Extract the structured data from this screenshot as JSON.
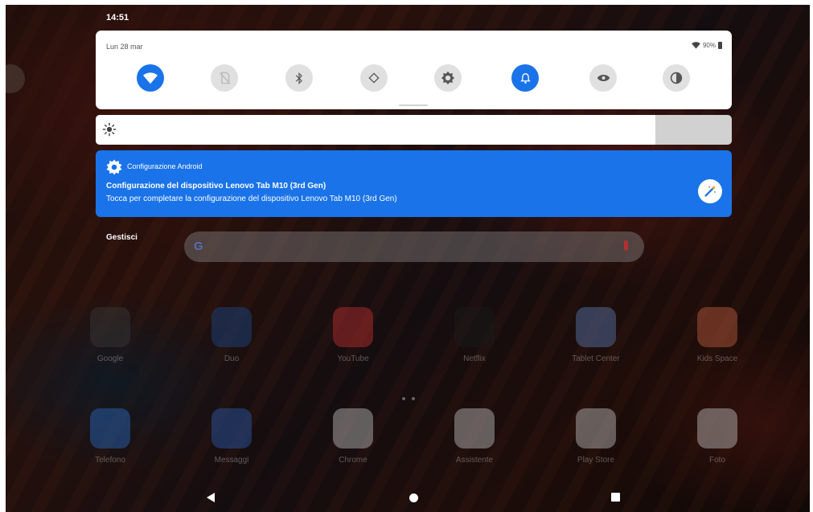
{
  "status_bar": {
    "time": "14:51"
  },
  "quick_settings": {
    "date": "Lun 28 mar",
    "battery": "90%",
    "tiles": [
      {
        "icon": "wifi-icon",
        "active": true
      },
      {
        "icon": "no-sim-icon",
        "active": false
      },
      {
        "icon": "bluetooth-icon",
        "active": false
      },
      {
        "icon": "auto-rotate-icon",
        "active": false
      },
      {
        "icon": "brightness-auto-icon",
        "active": false
      },
      {
        "icon": "bell-icon",
        "active": true
      },
      {
        "icon": "eye-icon",
        "active": false
      },
      {
        "icon": "contrast-icon",
        "active": false
      }
    ]
  },
  "brightness": {
    "level_percent": 88
  },
  "notification": {
    "app_name": "Configurazione Android",
    "title": "Configurazione del dispositivo Lenovo Tab M10 (3rd Gen)",
    "text": "Tocca per completare la configurazione del dispositivo Lenovo Tab M10 (3rd Gen)",
    "action_icon": "magic-wand-icon",
    "accent_color": "#1a73e8"
  },
  "manage_label": "Gestisci",
  "home": {
    "search_logo": "G",
    "apps": [
      {
        "label": "Google",
        "icon": "google-folder-icon"
      },
      {
        "label": "Duo",
        "icon": "duo-icon"
      },
      {
        "label": "YouTube",
        "icon": "youtube-icon"
      },
      {
        "label": "Netflix",
        "icon": "netflix-icon"
      },
      {
        "label": "Tablet Center",
        "icon": "tablet-center-icon"
      },
      {
        "label": "Kids Space",
        "icon": "kids-space-icon"
      },
      {
        "label": "Telefono",
        "icon": "phone-icon"
      },
      {
        "label": "Messaggi",
        "icon": "messages-icon"
      },
      {
        "label": "Chrome",
        "icon": "chrome-icon"
      },
      {
        "label": "Assistente",
        "icon": "assistant-icon"
      },
      {
        "label": "Play Store",
        "icon": "play-store-icon"
      },
      {
        "label": "Foto",
        "icon": "photos-icon"
      }
    ]
  }
}
